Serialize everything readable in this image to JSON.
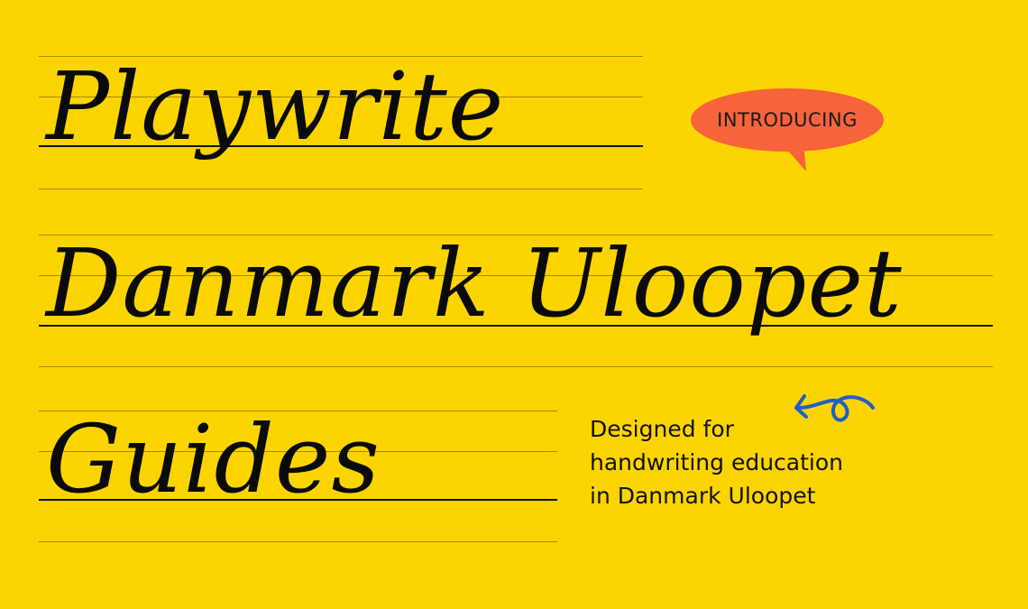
{
  "colors": {
    "background": "#FCD500",
    "bubble": "#F7633A",
    "arrow": "#1F5FC4",
    "ink": "#0A0A0A"
  },
  "headline": [
    {
      "word": "Playwrite"
    },
    {
      "word": "Danmark Uloopet"
    },
    {
      "word": "Guides"
    }
  ],
  "badge": {
    "label": "INTRODUCING"
  },
  "tagline": {
    "lines": [
      "Designed for",
      "handwriting education",
      "in Danmark Uloopet"
    ]
  },
  "decoration": {
    "arrow_icon": "curly-arrow-icon"
  }
}
